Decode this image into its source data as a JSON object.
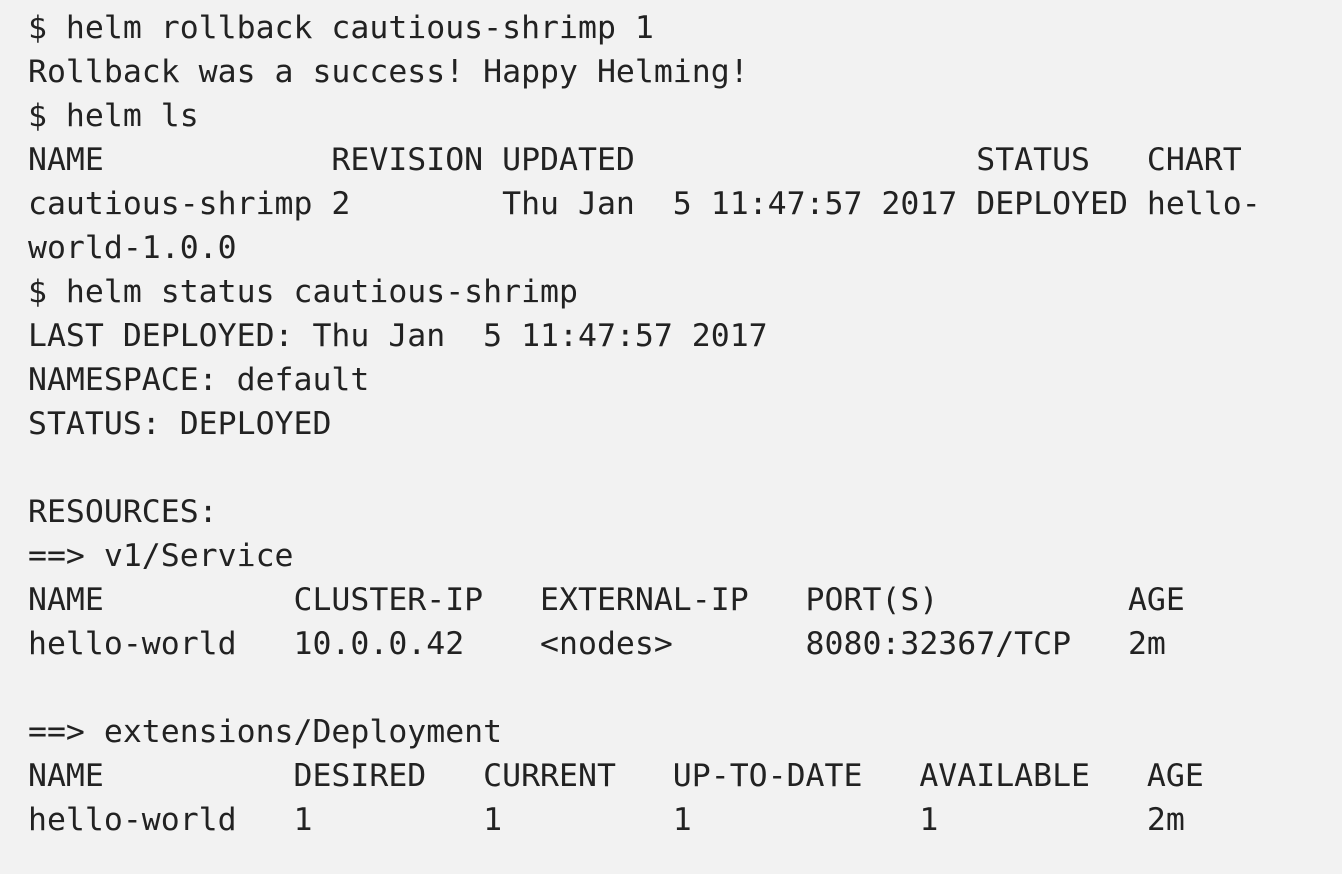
{
  "terminal": {
    "lines": [
      "$ helm rollback cautious-shrimp 1",
      "Rollback was a success! Happy Helming!",
      "$ helm ls",
      "NAME            REVISION UPDATED                  STATUS   CHART",
      "cautious-shrimp 2        Thu Jan  5 11:47:57 2017 DEPLOYED hello-",
      "world-1.0.0",
      "$ helm status cautious-shrimp",
      "LAST DEPLOYED: Thu Jan  5 11:47:57 2017",
      "NAMESPACE: default",
      "STATUS: DEPLOYED",
      "",
      "RESOURCES:",
      "==> v1/Service",
      "NAME          CLUSTER-IP   EXTERNAL-IP   PORT(S)          AGE",
      "hello-world   10.0.0.42    <nodes>       8080:32367/TCP   2m",
      "",
      "==> extensions/Deployment",
      "NAME          DESIRED   CURRENT   UP-TO-DATE   AVAILABLE   AGE",
      "hello-world   1         1         1            1           2m"
    ]
  }
}
